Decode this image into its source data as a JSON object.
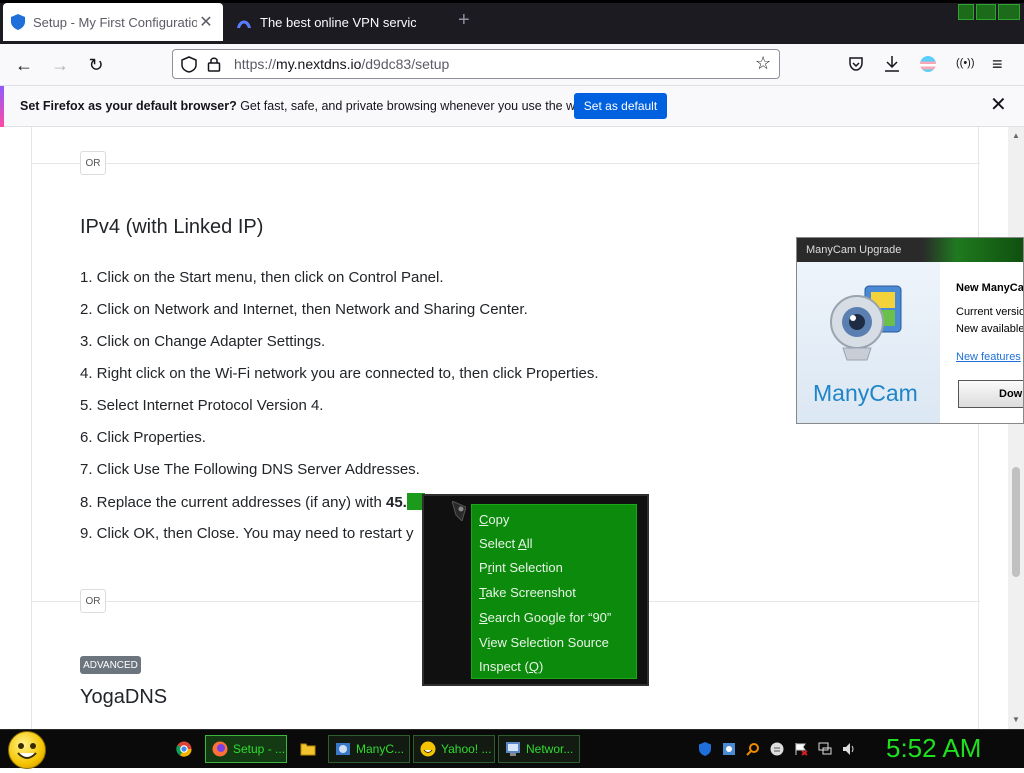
{
  "browser": {
    "tabs": [
      {
        "title": "Setup - My First Configuration",
        "active": true
      },
      {
        "title": "The best online VPN service for",
        "active": false
      }
    ],
    "url": {
      "scheme": "https://",
      "host": "my.nextdns.io",
      "path": "/d9dc83/setup"
    }
  },
  "notification": {
    "bold": "Set Firefox as your default browser?",
    "text": " Get fast, safe, and private browsing whenever you use the web.",
    "button": "Set as default"
  },
  "page": {
    "or_label": "OR",
    "section_title": "IPv4 (with Linked IP)",
    "steps": [
      "1. Click on the Start menu, then click on Control Panel.",
      "2. Click on Network and Internet, then Network and Sharing Center.",
      "3. Click on Change Adapter Settings.",
      "4. Right click on the Wi-Fi network you are connected to, then click Properties.",
      "5. Select Internet Protocol Version 4.",
      "6. Click Properties.",
      "7. Click Use The Following DNS Server Addresses.",
      "8. Replace the current addresses (if any) with ",
      "9. Click OK, then Close. You may need to restart y"
    ],
    "step8_bold": "45.",
    "advanced_badge": "ADVANCED",
    "next_title": "YogaDNS"
  },
  "manycam": {
    "title": "ManyCam Upgrade",
    "logo": "ManyCam",
    "heading": "New ManyCa",
    "current": "Current versio",
    "available": "New available",
    "link": "New features",
    "button": "Dow"
  },
  "context_menu": {
    "items": [
      {
        "key": "C",
        "rest": "opy"
      },
      {
        "pre": "Select ",
        "key": "A",
        "rest": "ll"
      },
      {
        "pre": "P",
        "key": "r",
        "rest": "int Selection"
      },
      {
        "key": "T",
        "rest": "ake Screenshot"
      },
      {
        "key": "S",
        "rest": "earch Google for “90”"
      },
      {
        "pre": "V",
        "key": "i",
        "rest": "ew Selection Source"
      },
      {
        "pre": "Inspect (",
        "key": "Q",
        "rest": ")"
      }
    ]
  },
  "taskbar": {
    "buttons": [
      "Setup - ...",
      "ManyC...",
      "Yahoo! ...",
      "Networ..."
    ],
    "clock": "5:52 AM"
  },
  "colors": {
    "accent_blue": "#0061e0",
    "taskbar_green": "#1fe01f",
    "menu_green": "#0b8a0b"
  }
}
